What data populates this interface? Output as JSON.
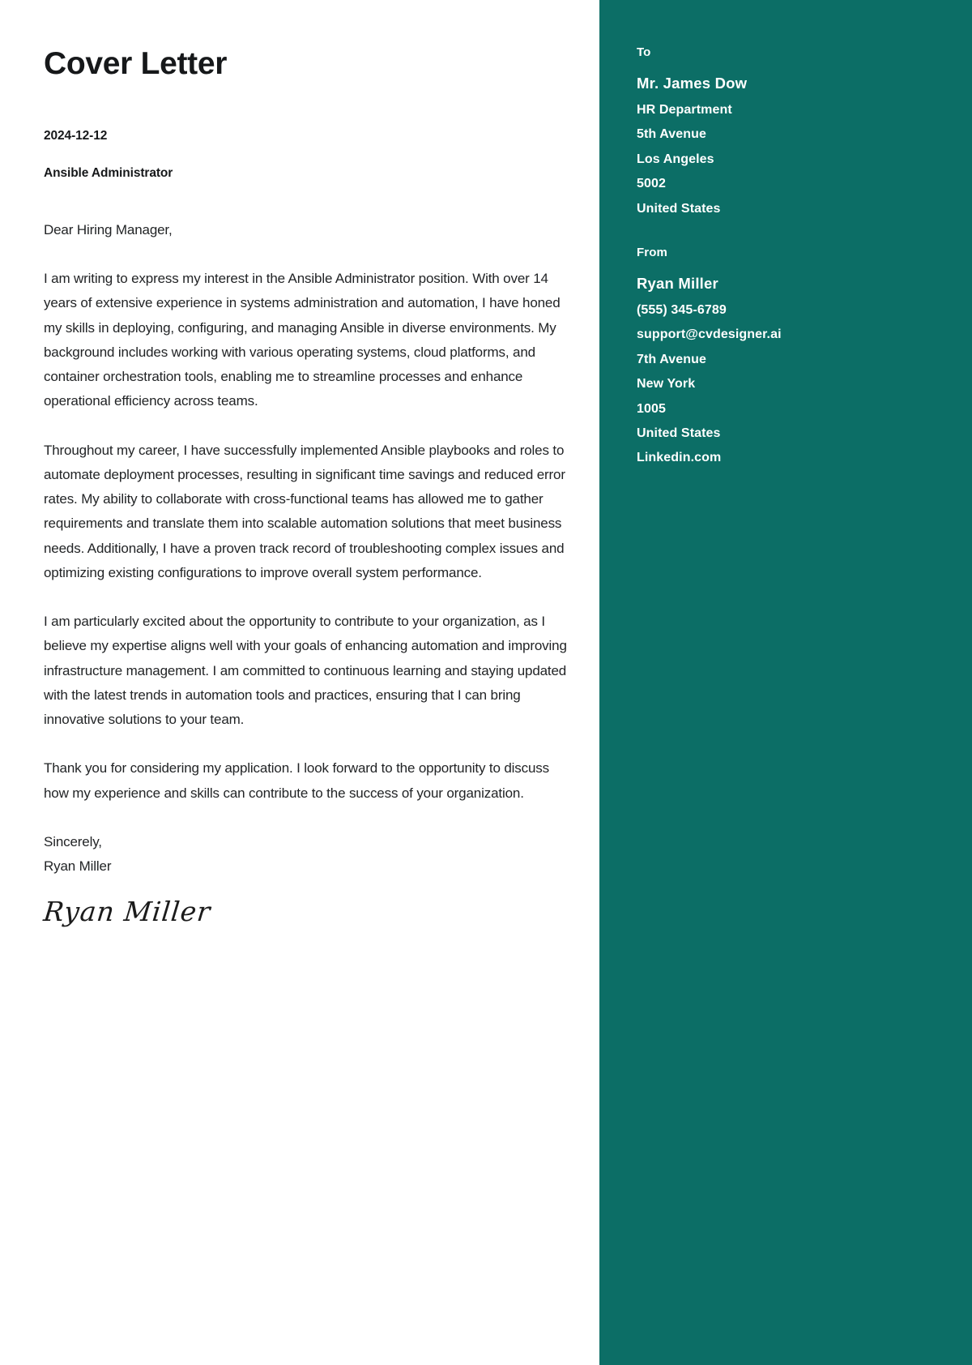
{
  "document": {
    "title": "Cover Letter",
    "date": "2024-12-12",
    "subject": "Ansible Administrator",
    "salutation": "Dear Hiring Manager,",
    "paragraphs": [
      "I am writing to express my interest in the Ansible Administrator position. With over 14 years of extensive experience in systems administration and automation, I have honed my skills in deploying, configuring, and managing Ansible in diverse environments. My background includes working with various operating systems, cloud platforms, and container orchestration tools, enabling me to streamline processes and enhance operational efficiency across teams.",
      "Throughout my career, I have successfully implemented Ansible playbooks and roles to automate deployment processes, resulting in significant time savings and reduced error rates. My ability to collaborate with cross-functional teams has allowed me to gather requirements and translate them into scalable automation solutions that meet business needs. Additionally, I have a proven track record of troubleshooting complex issues and optimizing existing configurations to improve overall system performance.",
      "I am particularly excited about the opportunity to contribute to your organization, as I believe my expertise aligns well with your goals of enhancing automation and improving infrastructure management. I am committed to continuous learning and staying updated with the latest trends in automation tools and practices, ensuring that I can bring innovative solutions to your team.",
      "Thank you for considering my application. I look forward to the opportunity to discuss how my experience and skills can contribute to the success of your organization."
    ],
    "closing_word": "Sincerely,",
    "closing_name": "Ryan Miller",
    "signature_mark": "Ryan Miller"
  },
  "sidebar": {
    "background_color": "#0c6e66",
    "text_color": "#ffffff",
    "to": {
      "label": "To",
      "name": "Mr. James Dow",
      "lines": [
        "HR Department",
        "5th Avenue",
        "Los Angeles",
        "5002",
        "United States"
      ]
    },
    "from": {
      "label": "From",
      "name": "Ryan Miller",
      "lines": [
        "(555) 345-6789",
        "support@cvdesigner.ai",
        "7th Avenue",
        "New York",
        "1005",
        "United States",
        "Linkedin.com"
      ]
    }
  }
}
